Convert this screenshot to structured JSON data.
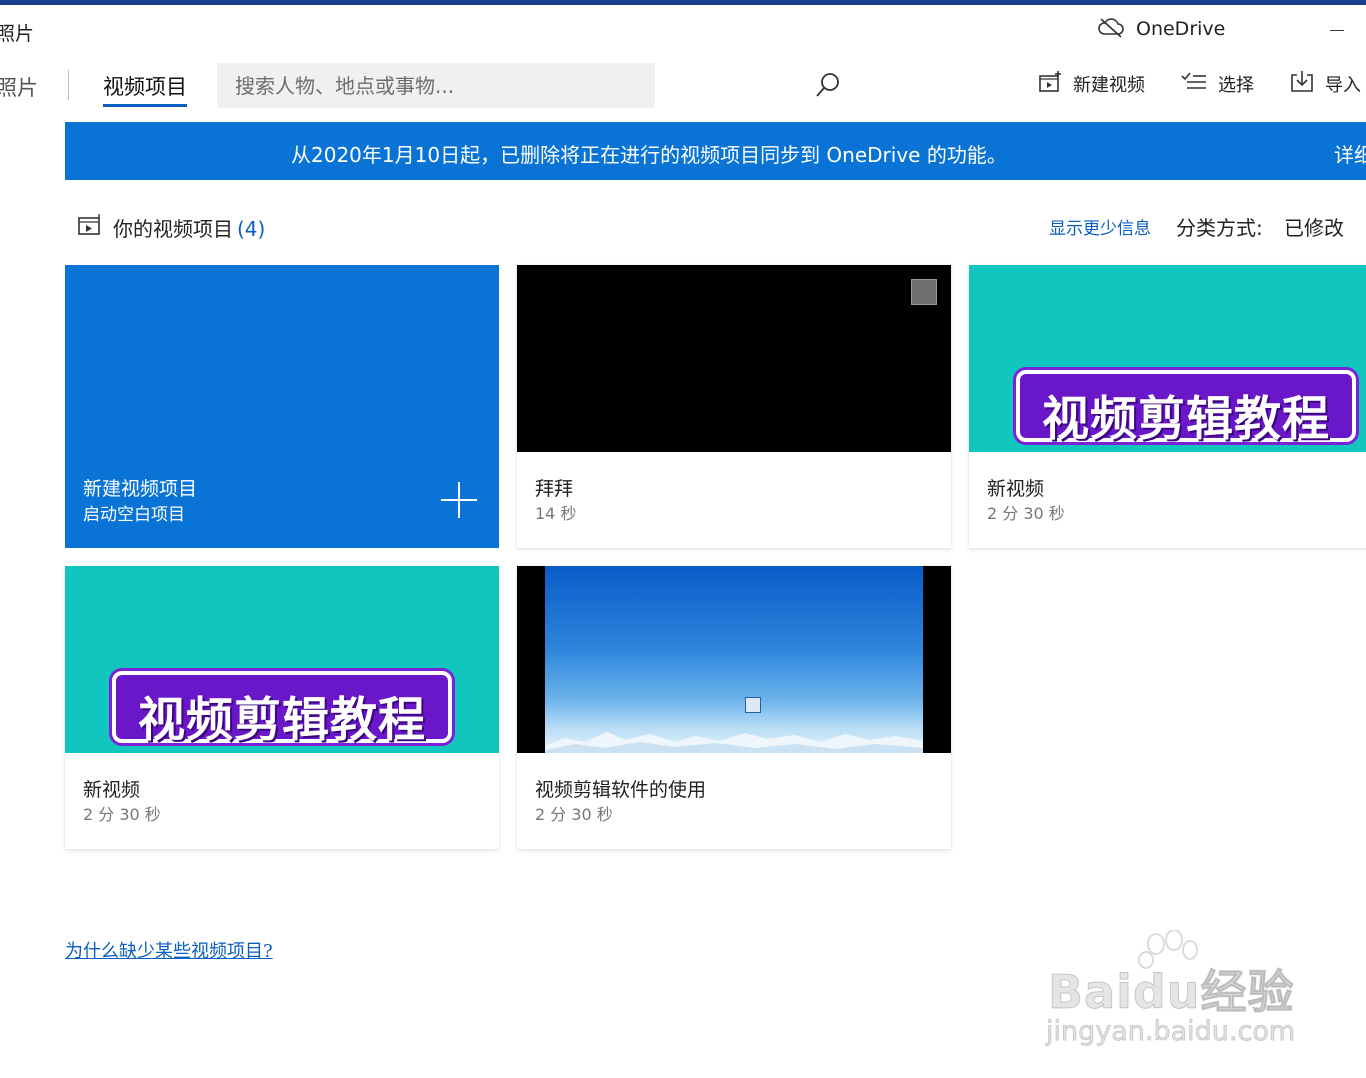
{
  "app": {
    "title": "照片"
  },
  "titlebar": {
    "onedrive_label": "OneDrive"
  },
  "nav": {
    "back_label": "照片",
    "active_tab": "视频项目",
    "search_placeholder": "搜索人物、地点或事物..."
  },
  "commands": {
    "new_video": "新建视频",
    "select": "选择",
    "import": "导入"
  },
  "banner": {
    "message": "从2020年1月10日起，已删除将正在进行的视频项目同步到 OneDrive 的功能。",
    "link": "详细"
  },
  "section": {
    "title": "你的视频项目",
    "count": "(4)",
    "show_less": "显示更少信息",
    "sort_label": "分类方式:",
    "sort_value": "已修改"
  },
  "new_card": {
    "title": "新建视频项目",
    "subtitle": "启动空白项目"
  },
  "projects": [
    {
      "name": "拜拜",
      "duration": "14 秒"
    },
    {
      "name": "新视频",
      "duration": "2 分 30 秒",
      "thumbnail_text": "视频剪辑教程"
    },
    {
      "name": "新视频",
      "duration": "2 分 30 秒",
      "thumbnail_text": "视频剪辑教程"
    },
    {
      "name": "视频剪辑软件的使用",
      "duration": "2 分 30 秒"
    }
  ],
  "footer": {
    "missing_link": "为什么缺少某些视频项目?"
  },
  "watermark": {
    "brand": "Baidu经验",
    "url": "jingyan.baidu.com"
  },
  "colors": {
    "accent": "#0a74d6",
    "link": "#0a5ec2",
    "thumbnail_teal": "#12c6c0",
    "thumbnail_purple": "#6a16c9"
  }
}
